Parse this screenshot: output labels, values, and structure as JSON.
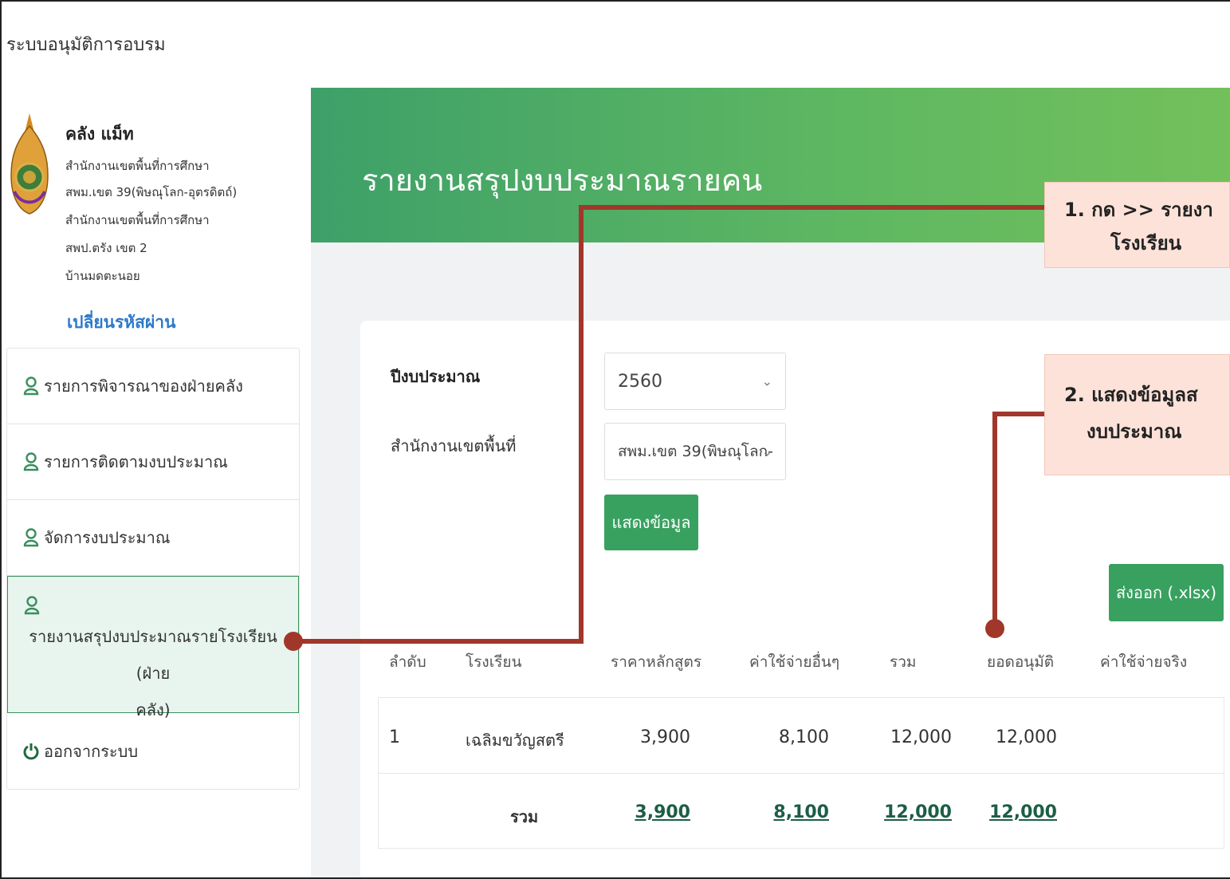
{
  "app": {
    "title": "ระบบอนุมัติการอบรม"
  },
  "profile": {
    "name": "คลัง แม็ท",
    "lines": [
      "สำนักงานเขตพื้นที่การศึกษา",
      "สพม.เขต 39(พิษณุโลก-อุตรดิตถ์)",
      "สำนักงานเขตพื้นที่การศึกษา",
      "สพป.ตรัง เขต 2",
      "บ้านมดตะนอย"
    ],
    "change_password": "เปลี่ยนรหัสผ่าน"
  },
  "menu": [
    {
      "label": "รายการพิจารณาของฝ่ายคลัง",
      "icon": "user-icon"
    },
    {
      "label": "รายการติดตามงบประมาณ",
      "icon": "user-icon"
    },
    {
      "label": "จัดการงบประมาณ",
      "icon": "user-icon"
    },
    {
      "label_line1": "รายงานสรุปงบประมาณรายโรงเรียน (ฝ่าย",
      "label_line2": "คลัง)",
      "icon": "user-icon",
      "active": true
    },
    {
      "label": "ออกจากระบบ",
      "icon": "power-icon"
    }
  ],
  "page": {
    "title": "รายงานสรุปงบประมาณรายคน"
  },
  "filters": {
    "year_label": "ปีงบประมาณ",
    "year_value": "2560",
    "area_label": "สำนักงานเขตพื้นที่",
    "area_value": "สพม.เขต 39(พิษณุโลก-",
    "show_button": "แสดงข้อมูล"
  },
  "export_button": "ส่งออก (.xlsx)",
  "table": {
    "headers": [
      "ลำดับ",
      "โรงเรียน",
      "ราคาหลักสูตร",
      "ค่าใช้จ่ายอื่นๆ",
      "รวม",
      "ยอดอนุมัติ",
      "ค่าใช้จ่ายจริง"
    ],
    "rows": [
      {
        "no": "1",
        "school": "เฉลิมขวัญสตรี",
        "course_price": "3,900",
        "other": "8,100",
        "sum": "12,000",
        "approved": "12,000",
        "actual": ""
      }
    ],
    "totals": {
      "label": "รวม",
      "course_price": "3,900",
      "other": "8,100",
      "sum": "12,000",
      "approved": "12,000"
    }
  },
  "annotations": {
    "step1": {
      "line1": "1. กด >> รายงา",
      "line2": "โรงเรียน"
    },
    "step2": {
      "line1": "2. แสดงข้อมูลส",
      "line2": "งบประมาณ"
    },
    "color": "#a0372a"
  },
  "colors": {
    "brand_green": "#39a160",
    "header_green": "#4cae63",
    "active_bg": "#e8f5ee",
    "link_blue": "#2e79c9"
  }
}
